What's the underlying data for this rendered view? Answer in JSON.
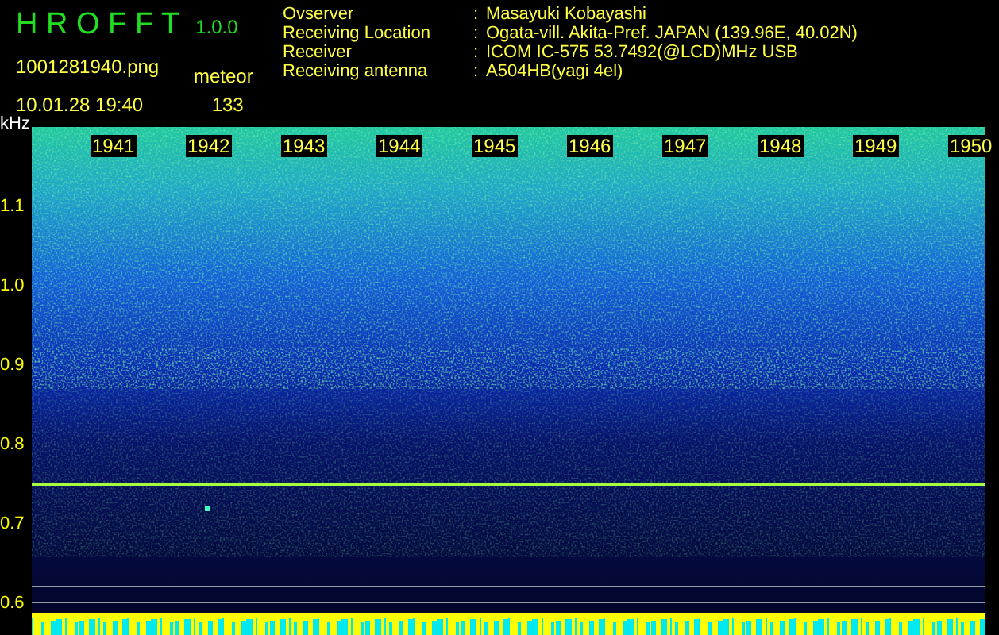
{
  "header": {
    "title": "H R O F F T",
    "version": "1.0.0",
    "filename": "1001281940.png",
    "datetime": "10.01.28 19:40",
    "detection_label": "meteor",
    "count": "133"
  },
  "info": [
    {
      "label": "Ovserver",
      "separator": ":",
      "value": "Masayuki Kobayashi"
    },
    {
      "label": "Receiving Location",
      "separator": ":",
      "value": "Ogata-vill. Akita-Pref. JAPAN (139.96E, 40.02N)"
    },
    {
      "label": "Receiver",
      "separator": ":",
      "value": "ICOM IC-575 53.7492(@LCD)MHz USB"
    },
    {
      "label": "Receiving antenna",
      "separator": ":",
      "value": "A504HB(yagi 4el)"
    }
  ],
  "spectrogram": {
    "unit": "kHz",
    "time_labels": [
      "1941",
      "1942",
      "1943",
      "1944",
      "1945",
      "1946",
      "1947",
      "1948",
      "1949",
      "1950"
    ],
    "freq_labels": [
      "1.1",
      "1.0",
      "0.9",
      "0.8",
      "0.7",
      "0.6"
    ]
  }
}
